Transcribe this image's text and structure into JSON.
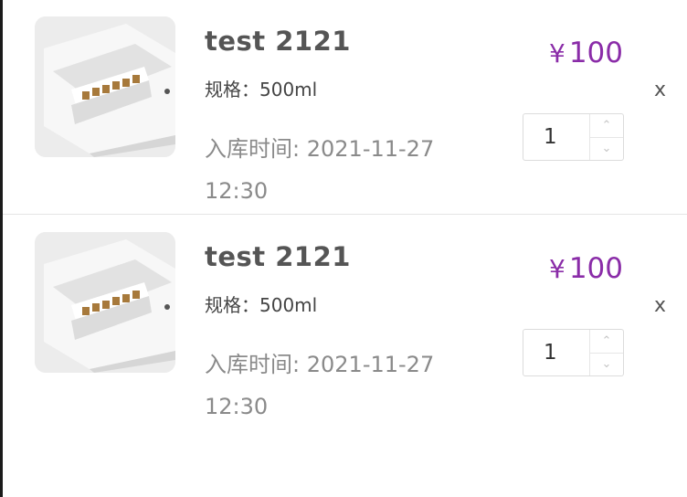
{
  "cart": {
    "items": [
      {
        "title": "test 2121",
        "spec_label": "规格：",
        "spec_value": "500ml",
        "stock_time_label": "入库时间:",
        "stock_time_value": "2021-11-27 12:30",
        "currency": "¥",
        "price": "100",
        "quantity": "1",
        "remove_label": "x",
        "image_icon": "product-photo"
      },
      {
        "title": "test 2121",
        "spec_label": "规格：",
        "spec_value": "500ml",
        "stock_time_label": "入库时间:",
        "stock_time_value": "2021-11-27 12:30",
        "currency": "¥",
        "price": "100",
        "quantity": "1",
        "remove_label": "x",
        "image_icon": "product-photo"
      }
    ],
    "colors": {
      "price": "#8a2ca8",
      "title": "#555555",
      "muted": "#8a8a8a"
    }
  }
}
